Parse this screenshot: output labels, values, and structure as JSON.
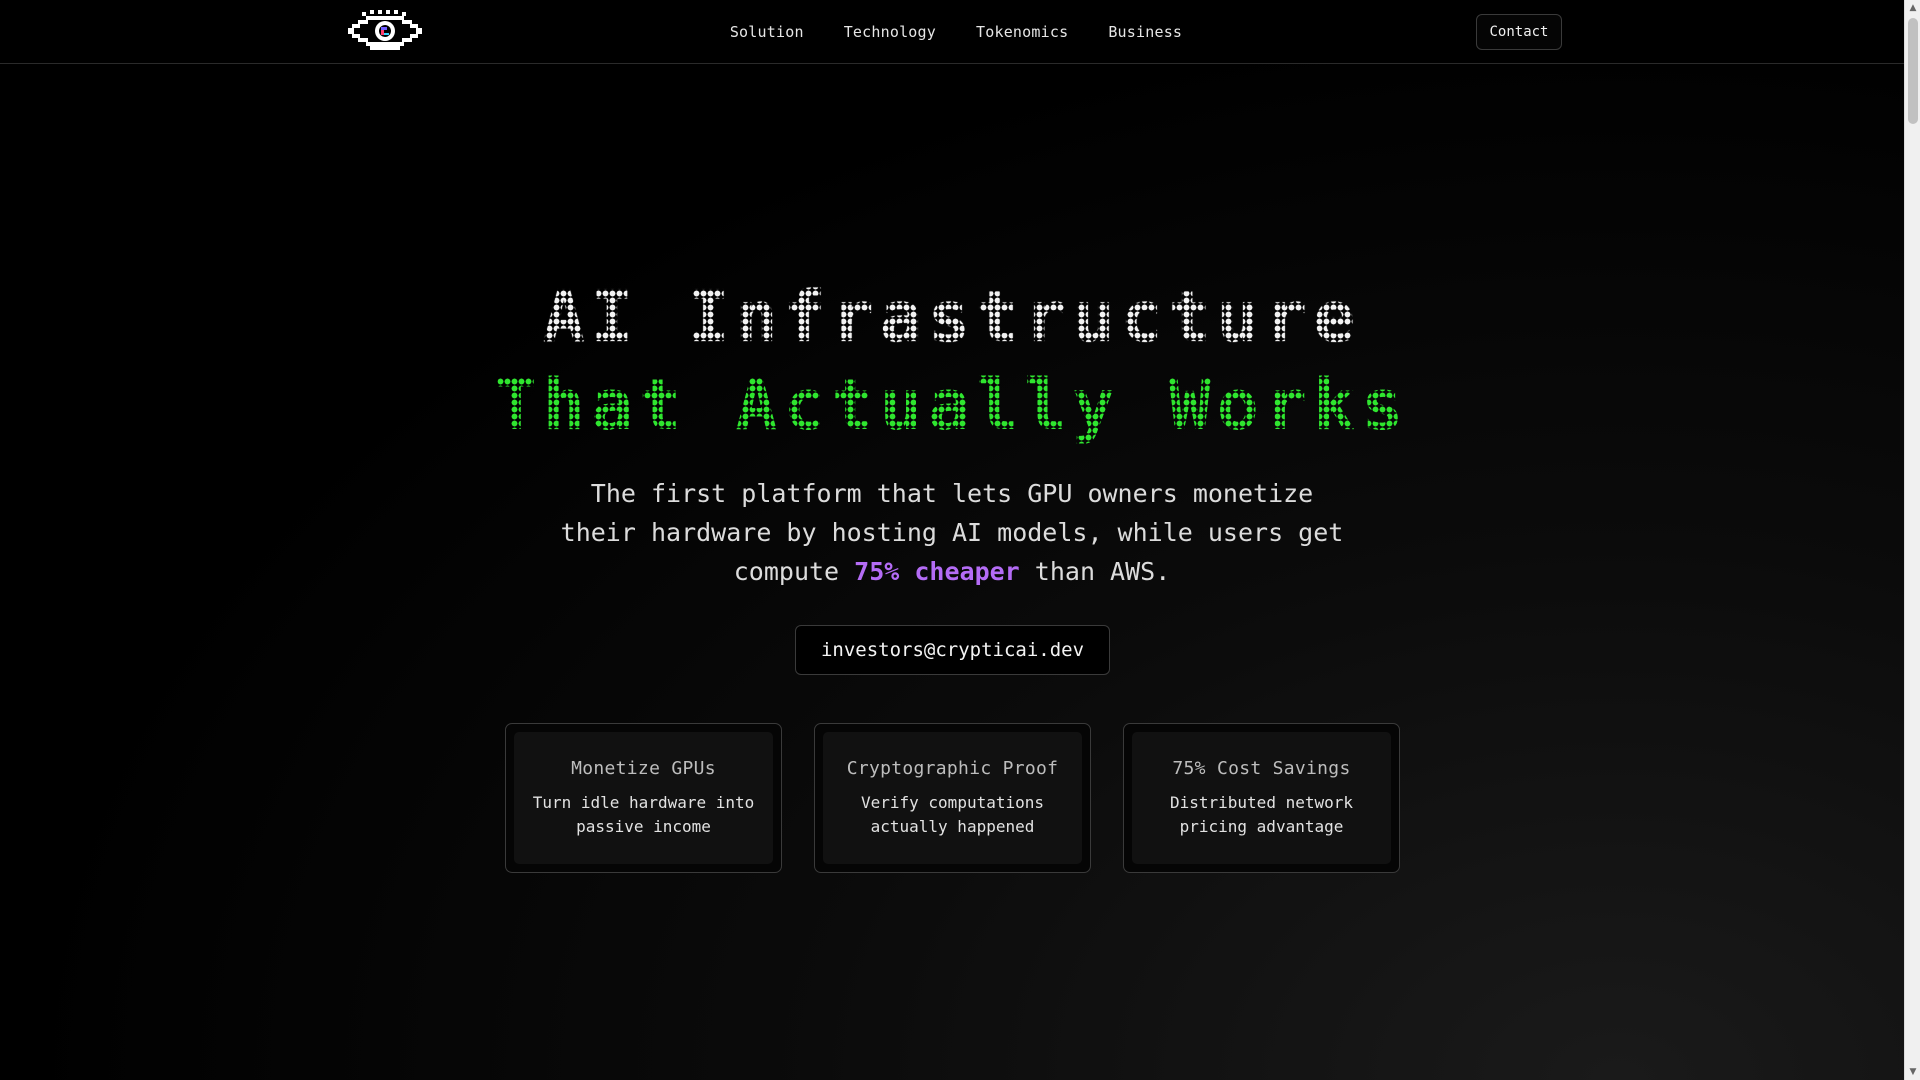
{
  "header": {
    "logo_icon": "pixel-eye-icon",
    "nav": [
      {
        "label": "Solution"
      },
      {
        "label": "Technology"
      },
      {
        "label": "Tokenomics"
      },
      {
        "label": "Business"
      }
    ],
    "contact_label": "Contact"
  },
  "hero": {
    "title_line1": "AI Infrastructure",
    "title_line2": "That Actually Works",
    "subtitle_before": "The first platform that lets GPU owners monetize their hardware by hosting AI models, while users get compute ",
    "subtitle_highlight": "75% cheaper",
    "subtitle_after": " than AWS.",
    "email": "investors@crypticai.dev"
  },
  "features": [
    {
      "title": "Monetize GPUs",
      "description": "Turn idle hardware into passive income"
    },
    {
      "title": "Cryptographic Proof",
      "description": "Verify computations actually happened"
    },
    {
      "title": "75% Cost Savings",
      "description": "Distributed network pricing advantage"
    }
  ],
  "colors": {
    "accent_green": "#2fe62f",
    "accent_purple": "#b46cf5",
    "background": "#000000"
  }
}
